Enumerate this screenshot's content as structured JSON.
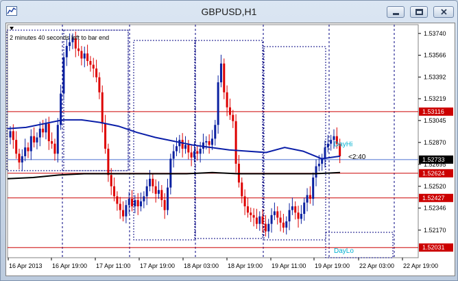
{
  "window": {
    "title": "GBPUSD,H1",
    "buttons": {
      "minimize": "minimize",
      "restore": "restore",
      "close": "✕"
    }
  },
  "chart_data": {
    "type": "candlestick",
    "symbol": "GBPUSD",
    "timeframe": "H1",
    "countdown_text": "2 minutes 40 seconds left to bar end",
    "price_marker_text": "<2:40",
    "ylim": [
      1.5195,
      1.5381
    ],
    "y_ticks": [
      "1.53740",
      "1.53566",
      "1.53392",
      "1.53219",
      "1.53045",
      "1.52870",
      "1.52695",
      "1.52520",
      "1.52346",
      "1.52170"
    ],
    "x_ticks": [
      "16 Apr 2013",
      "16 Apr 19:00",
      "17 Apr 11:00",
      "17 Apr 19:00",
      "18 Apr 03:00",
      "18 Apr 19:00",
      "19 Apr 11:00",
      "19 Apr 19:00",
      "22 Apr 03:00",
      "22 Apr 19:00"
    ],
    "horizontal_levels": [
      {
        "label": "1.53116",
        "value": 1.53116,
        "color": "#cc0000"
      },
      {
        "label": "1.52624",
        "value": 1.52624,
        "color": "#cc0000"
      },
      {
        "label": "1.52427",
        "value": 1.52427,
        "color": "#cc0000"
      },
      {
        "label": "1.52031",
        "value": 1.52031,
        "color": "#cc0000"
      }
    ],
    "current_price": {
      "label": "1.52733",
      "value": 1.52733
    },
    "annotations": [
      {
        "text": "DayHi",
        "value": 1.5286,
        "color": "#00b0d0"
      },
      {
        "text": "DayLo",
        "value": 1.5201,
        "color": "#00b0d0"
      }
    ],
    "closes": [
      1.5296,
      1.5289,
      1.5278,
      1.5271,
      1.5276,
      1.5283,
      1.528,
      1.5292,
      1.5287,
      1.5291,
      1.5298,
      1.5295,
      1.5302,
      1.5288,
      1.5286,
      1.5278,
      1.5301,
      1.5326,
      1.5355,
      1.5364,
      1.5367,
      1.537,
      1.5362,
      1.536,
      1.5354,
      1.5358,
      1.5352,
      1.5349,
      1.5346,
      1.5339,
      1.5327,
      1.5302,
      1.5282,
      1.5261,
      1.5252,
      1.5244,
      1.5238,
      1.5233,
      1.5228,
      1.5237,
      1.5242,
      1.5236,
      1.5241,
      1.5236,
      1.524,
      1.5244,
      1.5252,
      1.5258,
      1.5252,
      1.5246,
      1.5249,
      1.5241,
      1.5233,
      1.5251,
      1.5274,
      1.528,
      1.5284,
      1.5289,
      1.5282,
      1.5285,
      1.5279,
      1.5275,
      1.528,
      1.5278,
      1.5282,
      1.5287,
      1.5288,
      1.5285,
      1.529,
      1.5301,
      1.5335,
      1.535,
      1.5327,
      1.5315,
      1.5309,
      1.5304,
      1.527,
      1.5255,
      1.5244,
      1.5236,
      1.5231,
      1.5229,
      1.5227,
      1.5222,
      1.5228,
      1.5222,
      1.5216,
      1.5222,
      1.5229,
      1.5232,
      1.5227,
      1.5223,
      1.5219,
      1.5224,
      1.5233,
      1.5236,
      1.5231,
      1.5226,
      1.523,
      1.5239,
      1.5245,
      1.5242,
      1.5259,
      1.5268,
      1.527,
      1.5274,
      1.5283,
      1.5286,
      1.5289,
      1.5292,
      1.5286,
      1.5276
    ],
    "open_first": 1.5291,
    "ma_blue": [
      1.5298,
      1.5299,
      1.5302,
      1.5305,
      1.5305,
      1.5303,
      1.53,
      1.5295,
      1.5291,
      1.5288,
      1.5285,
      1.5283,
      1.5281,
      1.528,
      1.5279,
      1.5283,
      1.528,
      1.5274,
      1.5276
    ],
    "ma_black": [
      1.5258,
      1.5259,
      1.5261,
      1.5262,
      1.5262,
      1.5262,
      1.5262,
      1.5262,
      1.5263,
      1.5262,
      1.5262,
      1.5262,
      1.5262,
      1.5263
    ],
    "colors": {
      "up": "#0a20a0",
      "down": "#dd0000",
      "ma_blue": "#0a1ea8",
      "ma_black": "#000000",
      "grid": "#000080",
      "level": "#cc0000",
      "current": "#4a6fd0"
    }
  }
}
